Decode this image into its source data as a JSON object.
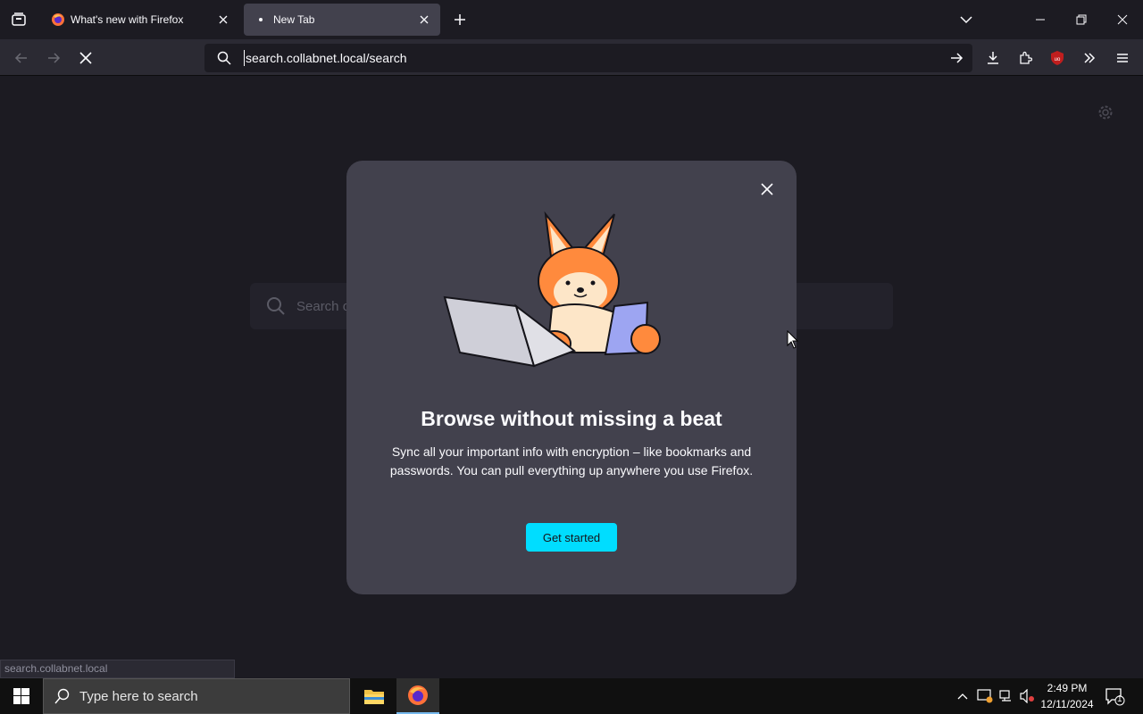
{
  "tabs": [
    {
      "title": "What's new with Firefox",
      "favicon": "firefox-icon"
    },
    {
      "title": "New Tab",
      "favicon": "loading-dot-icon"
    }
  ],
  "urlbar": {
    "value": "search.collabnet.local/search"
  },
  "newtab": {
    "search_placeholder": "Search o"
  },
  "modal": {
    "title": "Browse without missing a beat",
    "description": "Sync all your important info with encryption – like bookmarks and passwords. You can pull everything up anywhere you use Firefox.",
    "cta_label": "Get started",
    "illustration": "fox-with-laptop-and-phone"
  },
  "status": {
    "text": "search.collabnet.local"
  },
  "taskbar": {
    "search_placeholder": "Type here to search",
    "time": "2:49 PM",
    "date": "12/11/2024",
    "notification_count": "1"
  },
  "colors": {
    "accent": "#00ddff",
    "modal_bg": "#42414d",
    "page_bg": "#1c1b22"
  }
}
